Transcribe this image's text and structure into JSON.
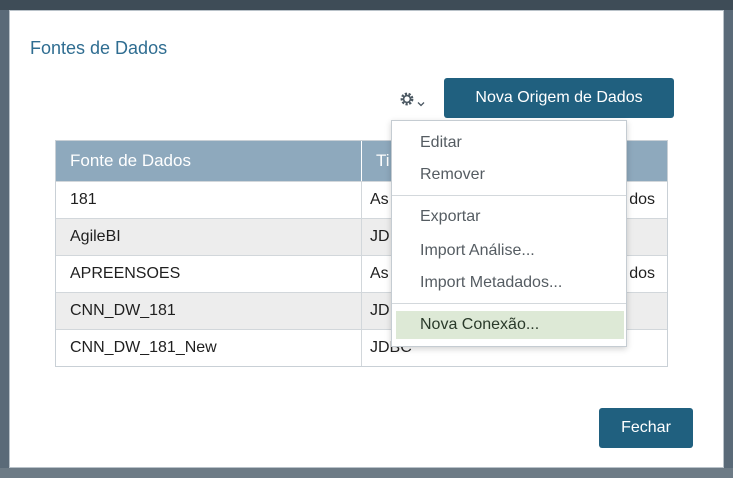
{
  "dialog": {
    "title": "Fontes de Dados",
    "new_source_label": "Nova Origem de Dados",
    "close_label": "Fechar"
  },
  "table": {
    "headers": [
      "Fonte de Dados",
      "Ti"
    ],
    "rows": [
      {
        "name": "181",
        "type": "As",
        "type_tail": "dos"
      },
      {
        "name": "AgileBI",
        "type": "JD",
        "type_tail": ""
      },
      {
        "name": "APREENSOES",
        "type": "As",
        "type_tail": "dos"
      },
      {
        "name": "CNN_DW_181",
        "type": "JD",
        "type_tail": ""
      },
      {
        "name": "CNN_DW_181_New",
        "type": "JDBC",
        "type_tail": ""
      }
    ]
  },
  "menu": {
    "items": [
      "Editar",
      "Remover",
      "Exportar",
      "Import Análise...",
      "Import Metadados...",
      "Nova Conexão..."
    ],
    "highlighted": "Nova Conexão..."
  },
  "colors": {
    "primary": "#20607f",
    "title": "#2f6d91",
    "header": "#8ea9bd",
    "highlight": "#dde9d6"
  },
  "icons": {
    "gear": "gear-icon",
    "dropdown": "caret-down-icon"
  }
}
